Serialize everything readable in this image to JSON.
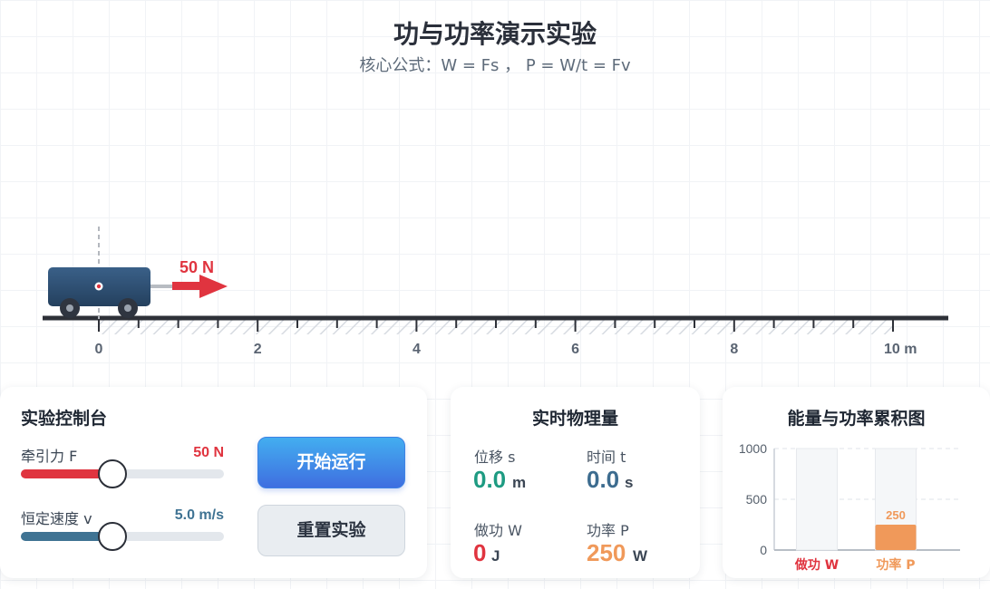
{
  "header": {
    "title": "功与功率演示实验",
    "subtitle": "核心公式：W = Fs ，  P = W/t = Fv"
  },
  "scene": {
    "force_label": "50 N",
    "ruler_ticks": [
      "0",
      "2",
      "4",
      "6",
      "8",
      "10 m"
    ],
    "colors": {
      "cart": "#2d4f72",
      "arrow": "#e0343f",
      "track": "#2e3138"
    }
  },
  "control": {
    "title": "实验控制台",
    "force": {
      "label": "牵引力 F",
      "value_text": "50 N",
      "fraction": 0.45,
      "color": "#e0343f"
    },
    "speed": {
      "label": "恒定速度 v",
      "value_text": "5.0 m/s",
      "fraction": 0.45,
      "color": "#3f7393"
    },
    "start_label": "开始运行",
    "reset_label": "重置实验"
  },
  "realtime": {
    "title": "实时物理量",
    "displacement": {
      "label": "位移 s",
      "value": "0.0",
      "unit": "m",
      "color": "#1e9b82"
    },
    "time": {
      "label": "时间 t",
      "value": "0.0",
      "unit": "s",
      "color": "#3d6c8f"
    },
    "work": {
      "label": "做功 W",
      "value": "0",
      "unit": "J",
      "color": "#e0343f"
    },
    "power": {
      "label": "功率 P",
      "value": "250",
      "unit": "W",
      "color": "#f0995a"
    }
  },
  "energy": {
    "title": "能量与功率累积图",
    "chart_data": {
      "type": "bar",
      "categories": [
        "做功 W",
        "功率 P"
      ],
      "values": [
        0,
        250
      ],
      "data_labels": [
        "",
        "250"
      ],
      "yticks": [
        "0",
        "500",
        "1000"
      ],
      "ylim": [
        0,
        1000
      ],
      "grid": true,
      "colors": [
        "#e0343f",
        "#f0995a"
      ]
    }
  }
}
